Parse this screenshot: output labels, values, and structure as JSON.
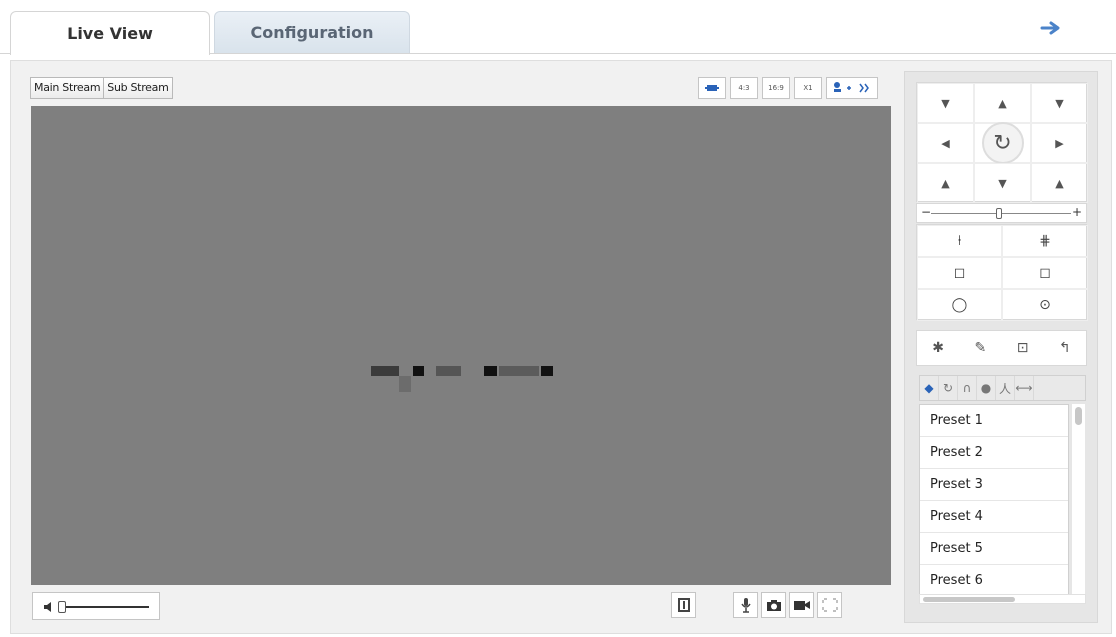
{
  "tabs": {
    "live_view": "Live View",
    "configuration": "Configuration"
  },
  "stream": {
    "main": "Main Stream",
    "sub": "Sub Stream"
  },
  "view_tools": {
    "ratio_43": "4:3",
    "ratio_169": "16:9",
    "scale_x1": "X1"
  },
  "presets": [
    "Preset 1",
    "Preset 2",
    "Preset 3",
    "Preset 4",
    "Preset 5",
    "Preset 6"
  ],
  "colors": {
    "accent": "#2a63b8",
    "video_bg": "#7f7f7f",
    "panel_bg": "#e6e6e6"
  },
  "icons": {
    "logout": "arrow-right-icon",
    "fit_window": "fit-window-icon",
    "ptz_rotate": "rotate-icon",
    "volume": "speaker-icon",
    "record": "video-camera-icon",
    "snapshot": "camera-icon",
    "talk": "microphone-icon"
  },
  "levels": {
    "zoom_slider": 0.5,
    "volume_slider": 0.05
  }
}
